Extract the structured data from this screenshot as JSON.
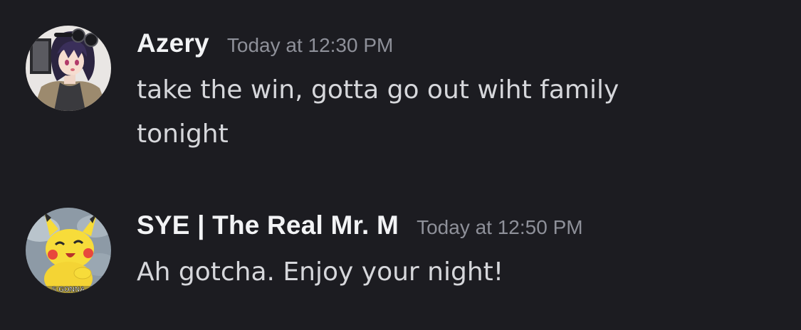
{
  "messages": [
    {
      "author": "Azery",
      "timestamp": "Today at 12:30 PM",
      "text": "take the win, gotta go out wiht family tonight",
      "avatar_icon": "anime-character-avatar-icon"
    },
    {
      "author": "SYE | The Real Mr. M",
      "timestamp": "Today at 12:50 PM",
      "text": "Ah gotcha. Enjoy your night!",
      "avatar_icon": "pikachu-avatar-icon",
      "avatar_caption": "S GONNA"
    }
  ],
  "colors": {
    "background": "#1c1c21",
    "username": "#f2f3f5",
    "timestamp": "#8e9099",
    "message_text": "#d6d7db"
  }
}
